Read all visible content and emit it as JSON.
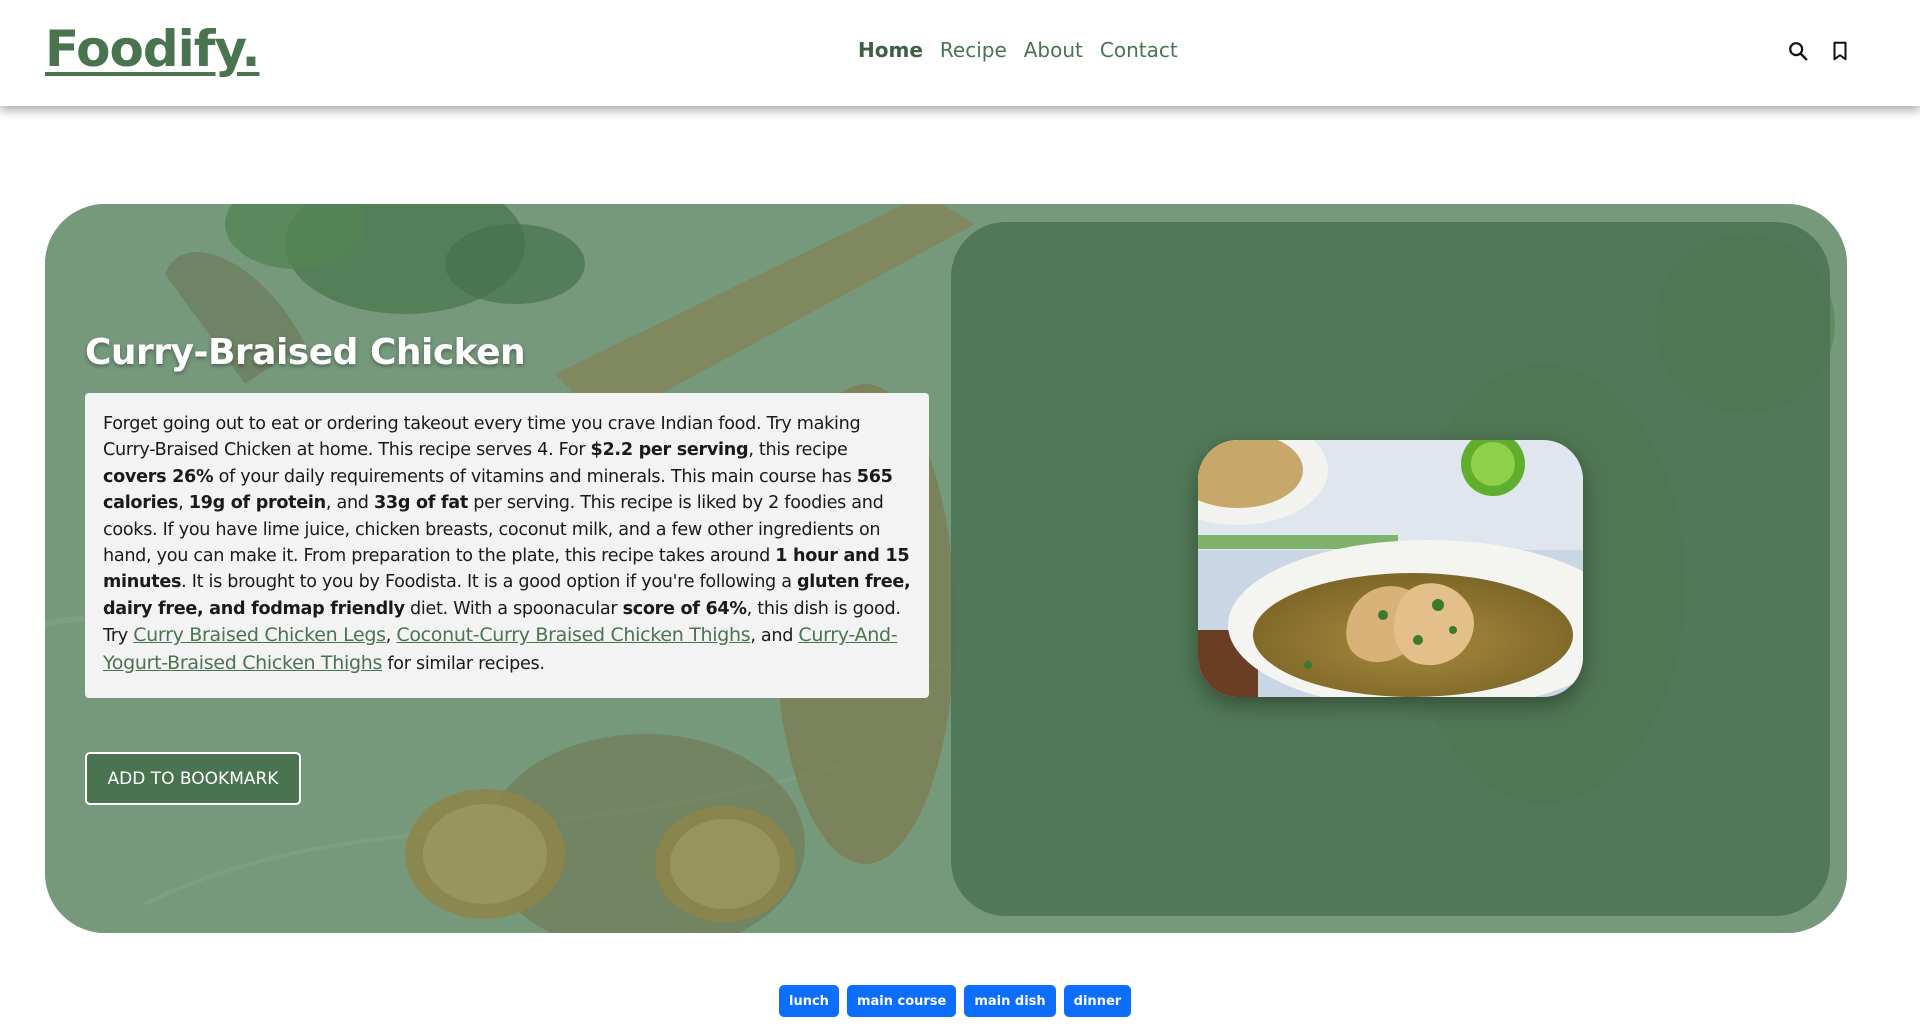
{
  "header": {
    "logo": "Foodify.",
    "nav": [
      {
        "label": "Home",
        "active": true
      },
      {
        "label": "Recipe",
        "active": false
      },
      {
        "label": "About",
        "active": false
      },
      {
        "label": "Contact",
        "active": false
      }
    ],
    "icons": [
      "search-icon",
      "bookmark-icon"
    ]
  },
  "recipe": {
    "title": "Curry-Braised Chicken",
    "summary": {
      "p1": "Forget going out to eat or ordering takeout every time you crave Indian food. Try making Curry-Braised Chicken at home. This recipe serves 4. For ",
      "b1": "$2.2 per serving",
      "p2": ", this recipe ",
      "b2": "covers 26%",
      "p3": " of your daily requirements of vitamins and minerals. This main course has ",
      "b3": "565 calories",
      "p4": ", ",
      "b4": "19g of protein",
      "p5": ", and ",
      "b5": "33g of fat",
      "p6": " per serving. This recipe is liked by 2 foodies and cooks. If you have lime juice, chicken breasts, coconut milk, and a few other ingredients on hand, you can make it. From preparation to the plate, this recipe takes around ",
      "b6": "1 hour and 15 minutes",
      "p7": ". It is brought to you by Foodista. It is a good option if you're following a ",
      "b7": "gluten free, dairy free, and fodmap friendly",
      "p8": " diet. With a spoonacular ",
      "b8": "score of 64%",
      "p9": ", this dish is good. Try ",
      "link1": "Curry Braised Chicken Legs",
      "sep1": ", ",
      "link2": "Coconut-Curry Braised Chicken Thighs",
      "sep2": ", and ",
      "link3": "Curry-And-Yogurt-Braised Chicken Thighs",
      "p10": " for similar recipes."
    },
    "bookmark_button": "ADD TO BOOKMARK"
  },
  "tags": [
    "lunch",
    "main course",
    "main dish",
    "dinner"
  ],
  "colors": {
    "brand": "#4a7350",
    "hero_overlay": "#5a8260",
    "panel": "#4c7452",
    "tag": "#0d6efd"
  }
}
